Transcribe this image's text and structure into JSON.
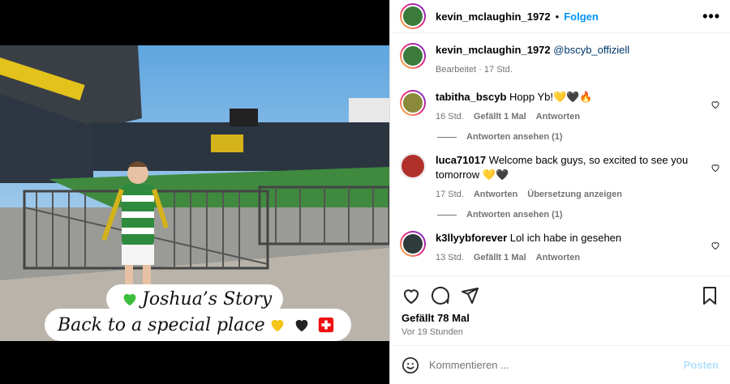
{
  "post": {
    "username": "kevin_mclaughin_1972",
    "separator": "•",
    "follow_label": "Folgen",
    "more_label": "•••",
    "caption_mention": "@bscyb_offiziell",
    "caption_meta": "Bearbeitet · 17 Std.",
    "image_caption_line1": "Joshua’s Story",
    "image_caption_line2": "Back to a special place",
    "likes": "Gefällt 78 Mal",
    "posted_ago": "Vor 19 Stunden"
  },
  "comments": [
    {
      "user": "tabitha_bscyb",
      "text": "Hopp Yb!💛🖤🔥",
      "time": "16 Std.",
      "likes": "Gefällt 1 Mal",
      "reply": "Antworten",
      "view_replies": "Antworten ansehen (1)"
    },
    {
      "user": "luca71017",
      "text": "Welcome back guys, so excited to see you tomorrow 💛🖤",
      "time": "17 Std.",
      "reply": "Antworten",
      "translate": "Übersetzung anzeigen",
      "view_replies": "Antworten ansehen (1)"
    },
    {
      "user": "k3llyybforever",
      "text": "Lol ich habe in gesehen",
      "time": "13 Std.",
      "likes": "Gefällt 1 Mal",
      "reply": "Antworten"
    }
  ],
  "comment_box": {
    "placeholder": "Kommentieren ...",
    "post_label": "Posten"
  },
  "colors": {
    "accent": "#0095f6",
    "muted": "#737373"
  }
}
